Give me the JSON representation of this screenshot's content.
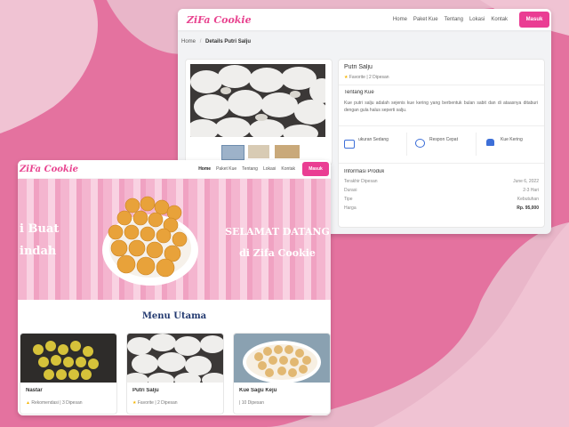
{
  "colors": {
    "accent": "#ea3d93",
    "brand_logo": "#e8438f",
    "page_bg": "#e9b6c9",
    "blob": "#e4729f"
  },
  "detail_page": {
    "logo": "ZiFa Cookie",
    "nav": [
      "Home",
      "Paket Kue",
      "Tentang",
      "Lokasi",
      "Kontak"
    ],
    "login": "Masuk",
    "breadcrumb": {
      "home": "Home",
      "separator": "/",
      "current": "Details Putri Salju"
    },
    "product": {
      "name": "Putri Salju",
      "favorite": "Favorite",
      "orders": "2 Dipesan"
    },
    "about": {
      "title": "Tentang Kue",
      "text": "Kue putri salju adalah sejenis kue kering yang berbentuk bulan sabit dan di ataasnya ditaburi dengan gula halus seperti salju."
    },
    "features": [
      {
        "icon": "size-icon",
        "label": "ukuran Sedang"
      },
      {
        "icon": "chat-icon",
        "label": "Respon Cepat"
      },
      {
        "icon": "cake-icon",
        "label": "Kue Kering"
      }
    ],
    "info": {
      "title": "Informasi Produk",
      "rows": [
        {
          "label": "Terakhir Dipesan",
          "value": "June 6, 2022"
        },
        {
          "label": "Durasi",
          "value": "2-3 Hari"
        },
        {
          "label": "Tipe",
          "value": "Kebutuhan"
        },
        {
          "label": "Harga",
          "value": "Rp. 95,000"
        }
      ]
    }
  },
  "home_page": {
    "logo": "ZiFa Cookie",
    "nav": [
      "Home",
      "Paket Kue",
      "Tentang",
      "Lokasi",
      "Kontak"
    ],
    "login": "Masuk",
    "hero": {
      "left_line1": "i Buat",
      "left_line2": "indah",
      "right_line1": "SELAMAT DATANG",
      "right_line2": "di Zifa Cookie"
    },
    "menu_title": "Menu Utama",
    "cards": [
      {
        "name": "Nastar",
        "tag": "Rekomendasi",
        "orders": "3 Dipesan"
      },
      {
        "name": "Putri Salju",
        "tag": "Favorite",
        "orders": "2 Dipesan"
      },
      {
        "name": "Kue Sagu Keju",
        "tag": "",
        "orders": "| 10 Dipesan"
      }
    ]
  }
}
